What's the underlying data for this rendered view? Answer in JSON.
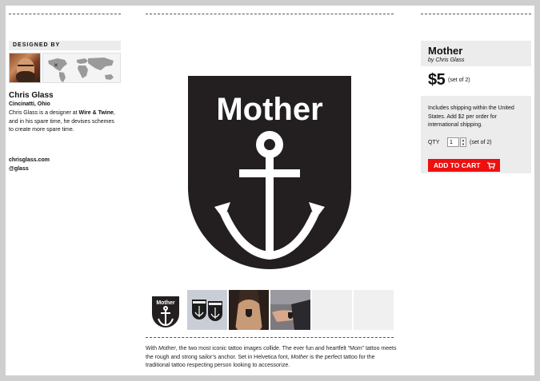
{
  "designer": {
    "heading": "DESIGNED BY",
    "name": "Chris Glass",
    "location": "Cincinatti, Ohio",
    "bio_prefix": "Chris Glass is a designer at ",
    "bio_company": "Wire & Twine",
    "bio_suffix": ", and in his spare time, he devises schemes to create more spare time.",
    "website": "chrisglass.com",
    "handle": "@glass"
  },
  "main_image": {
    "badge_text": "Mother"
  },
  "thumbnails": [
    {
      "kind": "logo"
    },
    {
      "kind": "sticker-photo"
    },
    {
      "kind": "chest-tattoo-photo"
    },
    {
      "kind": "arm-tattoo-photo"
    },
    {
      "kind": "empty"
    },
    {
      "kind": "empty"
    }
  ],
  "description": {
    "part1": "With ",
    "title_italic": "Mother",
    "part2": ", the two most iconic tattoo images collide. The ever fun and heartfelt “Mom” tattoo meets the rough and strong sailor’s anchor. Set in Helvetica font, ",
    "title_italic2": "Mother",
    "part3": " is the perfect tattoo for the traditional tattoo respecting person looking to accessorize."
  },
  "product": {
    "title": "Mother",
    "by": "by Chris Glass",
    "price": "$5",
    "price_note": "(set of 2)",
    "shipping": "Includes shipping within the United States. Add $2 per order for international shipping.",
    "qty_label": "QTY",
    "qty_value": "1",
    "qty_note": "(set of 2)",
    "add_to_cart": "ADD TO CART"
  },
  "colors": {
    "accent": "#ee1010",
    "badge": "#231f20"
  }
}
